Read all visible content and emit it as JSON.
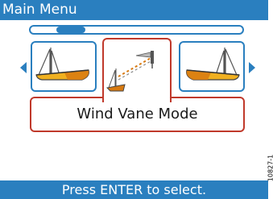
{
  "title_bar": {
    "title": "Main Menu"
  },
  "scroll_indicator": {
    "position": 0.14
  },
  "carousel": {
    "left_arrow_icon": "triangle-left-icon",
    "right_arrow_icon": "triangle-right-icon",
    "items": [
      {
        "icon": "boat-pointing-left-icon",
        "selected": false
      },
      {
        "icon": "wind-vane-icon",
        "selected": true
      },
      {
        "icon": "boat-pointing-right-icon",
        "selected": false
      }
    ],
    "selected_label": "Wind Vane Mode"
  },
  "status_bar": {
    "text": "Press ENTER to select."
  },
  "figure_code": "10827-1",
  "colors": {
    "accent_blue": "#2a7fbf",
    "selection_red": "#c0392b",
    "boat_yellow": "#f0b020",
    "boat_orange": "#d87a10"
  }
}
